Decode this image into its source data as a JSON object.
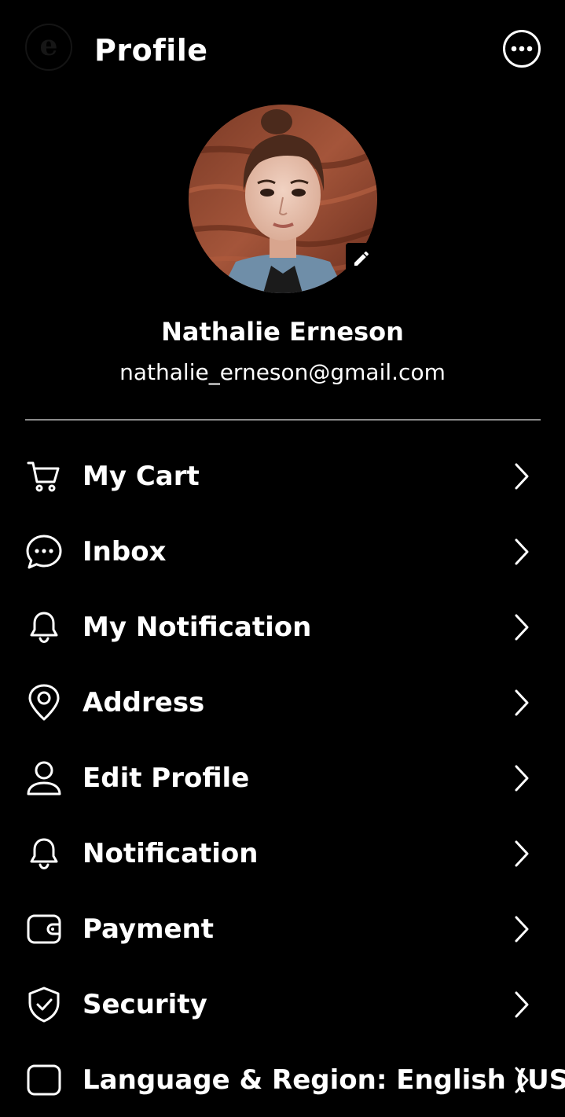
{
  "header": {
    "logo_letter": "e",
    "title": "Profile",
    "more_icon": "more-horizontal-icon"
  },
  "profile": {
    "name": "Nathalie Erneson",
    "email": "nathalie_erneson@gmail.com",
    "edit_icon": "pencil-icon"
  },
  "menu": {
    "items": [
      {
        "label": "My Cart",
        "icon": "cart-icon"
      },
      {
        "label": "Inbox",
        "icon": "chat-bubble-icon"
      },
      {
        "label": "My Notification",
        "icon": "bell-icon"
      },
      {
        "label": "Address",
        "icon": "location-pin-icon"
      },
      {
        "label": "Edit Profile",
        "icon": "user-icon"
      },
      {
        "label": "Notification",
        "icon": "bell-icon"
      },
      {
        "label": "Payment",
        "icon": "wallet-icon"
      },
      {
        "label": "Security",
        "icon": "shield-check-icon"
      },
      {
        "label": "Language & Region: English (US)",
        "icon": "document-icon"
      }
    ]
  },
  "colors": {
    "background": "#000000",
    "text": "#ffffff",
    "divider": "#8a8a8a"
  }
}
